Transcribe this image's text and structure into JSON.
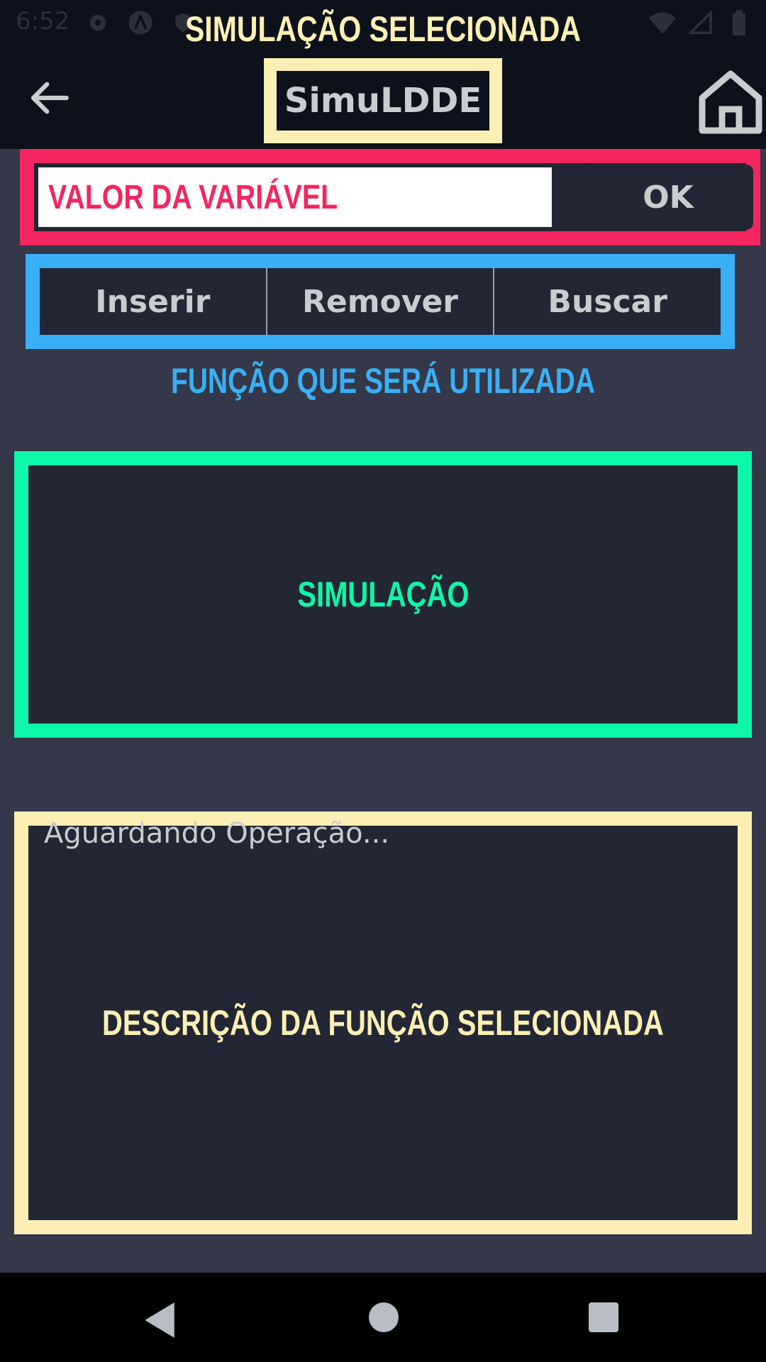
{
  "status_bar": {
    "time": "6:52",
    "left_icons": [
      "gear-icon",
      "a-logo-icon",
      "shield-icon"
    ],
    "right_icons": [
      "wifi-icon",
      "signal-icon",
      "battery-icon"
    ]
  },
  "header": {
    "overlay_title": "SIMULAÇÃO SELECIONADA",
    "app_title": "SimuLDDE",
    "back_icon": "arrow-left-icon",
    "home_icon": "home-icon"
  },
  "input_section": {
    "placeholder": "VALOR DA VARIÁVEL",
    "ok_label": "OK",
    "border_color": "#f4265f"
  },
  "operations": {
    "buttons": [
      "Inserir",
      "Remover",
      "Buscar"
    ],
    "caption": "FUNÇÃO QUE SERÁ UTILIZADA",
    "border_color": "#39aff5"
  },
  "simulation": {
    "label": "SIMULAÇÃO",
    "border_color": "#0cf7a9"
  },
  "description": {
    "status": "Aguardando Operação...",
    "label": "DESCRIÇÃO DA FUNÇÃO SELECIONADA",
    "border_color": "#fcefb3"
  },
  "nav_bar": {
    "icons": [
      "nav-back-icon",
      "nav-home-icon",
      "nav-recents-icon"
    ]
  }
}
